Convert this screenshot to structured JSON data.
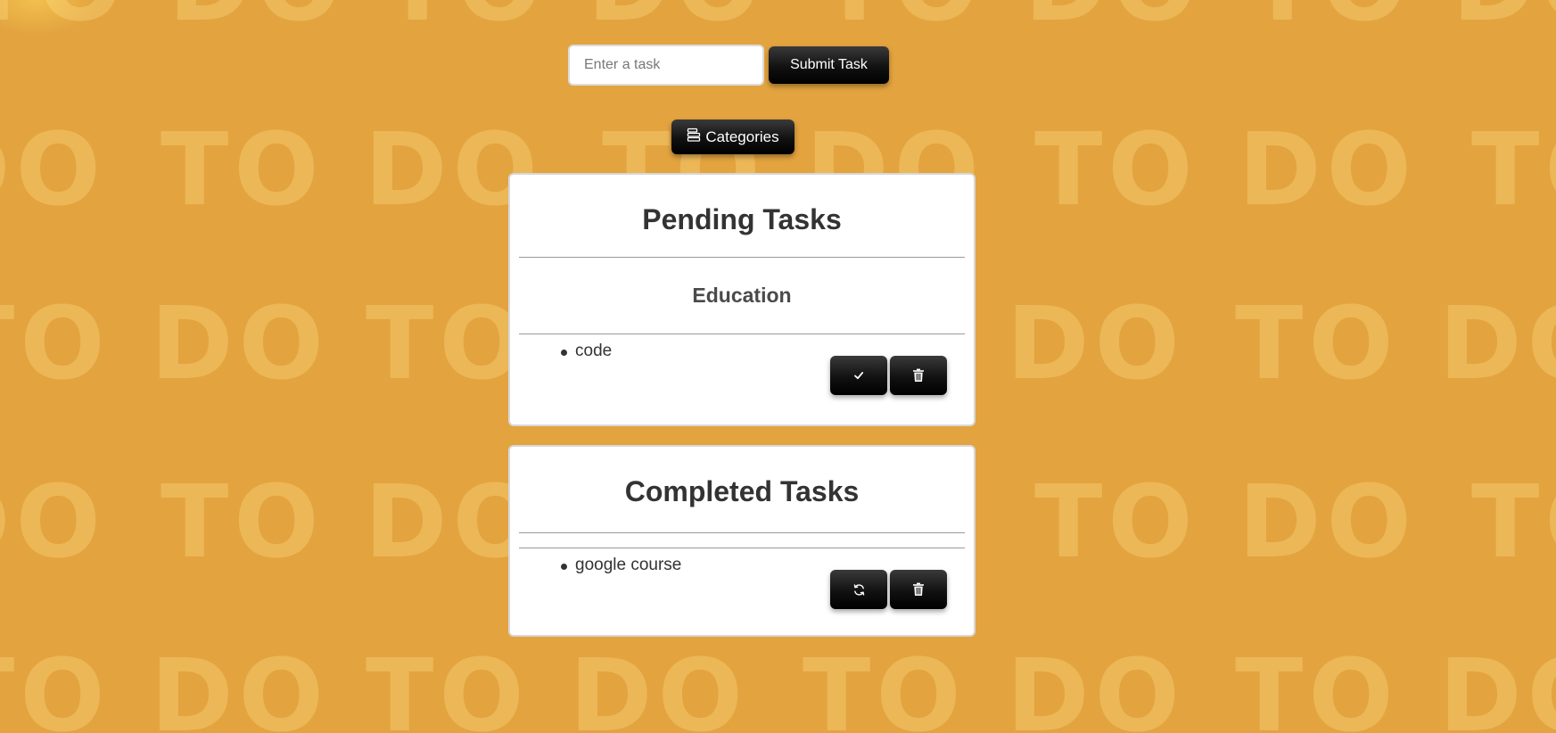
{
  "form": {
    "input_placeholder": "Enter a task",
    "input_value": "",
    "submit_label": "Submit Task"
  },
  "categories_button": {
    "label": "Categories",
    "icon": "stack-icon"
  },
  "pending": {
    "title": "Pending Tasks",
    "categories": [
      {
        "name": "Education",
        "tasks": [
          {
            "text": "code",
            "actions": [
              "check-icon",
              "trash-icon"
            ]
          }
        ]
      }
    ]
  },
  "completed": {
    "title": "Completed Tasks",
    "tasks": [
      {
        "text": "google course",
        "actions": [
          "refresh-icon",
          "trash-icon"
        ]
      }
    ]
  },
  "background": {
    "pattern_text": "TO DO",
    "color": "#e3a33f",
    "pattern_color": "#ffe28c"
  }
}
